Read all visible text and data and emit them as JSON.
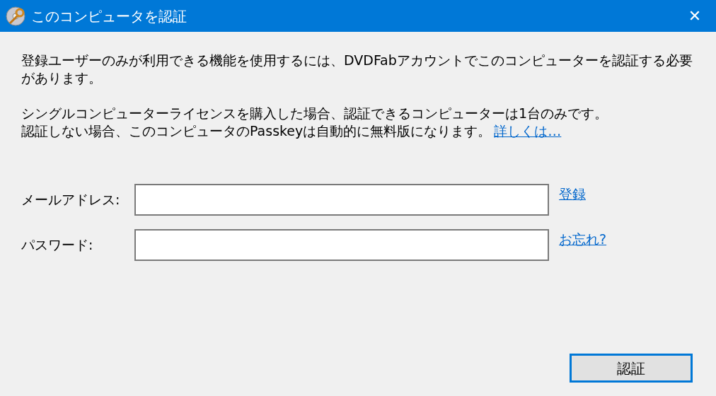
{
  "window": {
    "title": "このコンピュータを認証",
    "close": "✕"
  },
  "message": {
    "paragraph_1": "登録ユーザーのみが利用できる機能を使用するには、DVDFabアカウントでこのコンピューターを認証する必要があります。",
    "line_2": "シングルコンピューターライセンスを購入した場合、認証できるコンピューターは1台のみです。",
    "line_3": "認証しない場合、このコンピュータのPasskeyは自動的に無料版になります。",
    "link": "詳しくは…"
  },
  "fields": [
    {
      "label": "メールアドレス:",
      "link": "登録"
    },
    {
      "label": "パスワード:",
      "link": "お忘れ?"
    }
  ],
  "button": "認証"
}
